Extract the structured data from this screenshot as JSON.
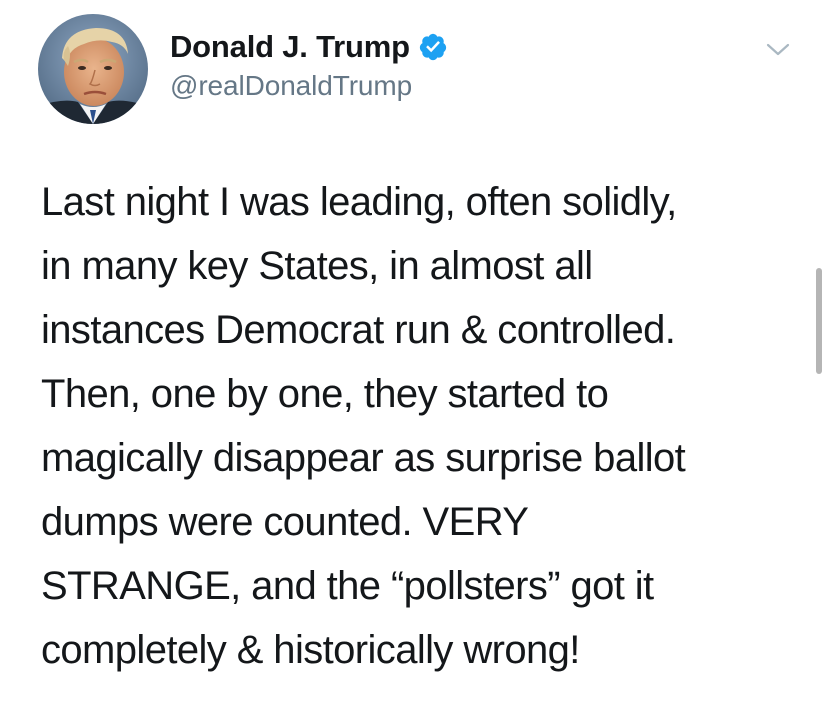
{
  "author": {
    "display_name": "Donald J. Trump",
    "handle": "@realDonaldTrump",
    "verified": true,
    "avatar_icon": "profile-photo",
    "verified_icon": "verified-badge-icon"
  },
  "menu": {
    "icon": "chevron-down-icon"
  },
  "tweet": {
    "lines": [
      "Last night I was leading, often solidly,",
      "in many key States, in almost all",
      "instances Democrat run & controlled.",
      "Then, one by one, they started to",
      "magically disappear as surprise ballot",
      "dumps were counted. VERY",
      "STRANGE, and the “pollsters” got it",
      "completely & historically wrong!"
    ]
  },
  "colors": {
    "text": "#14171a",
    "secondary": "#657786",
    "verified_blue": "#1da1f2",
    "chevron": "#aab8c2",
    "scrollbar": "#b5b5b5"
  }
}
